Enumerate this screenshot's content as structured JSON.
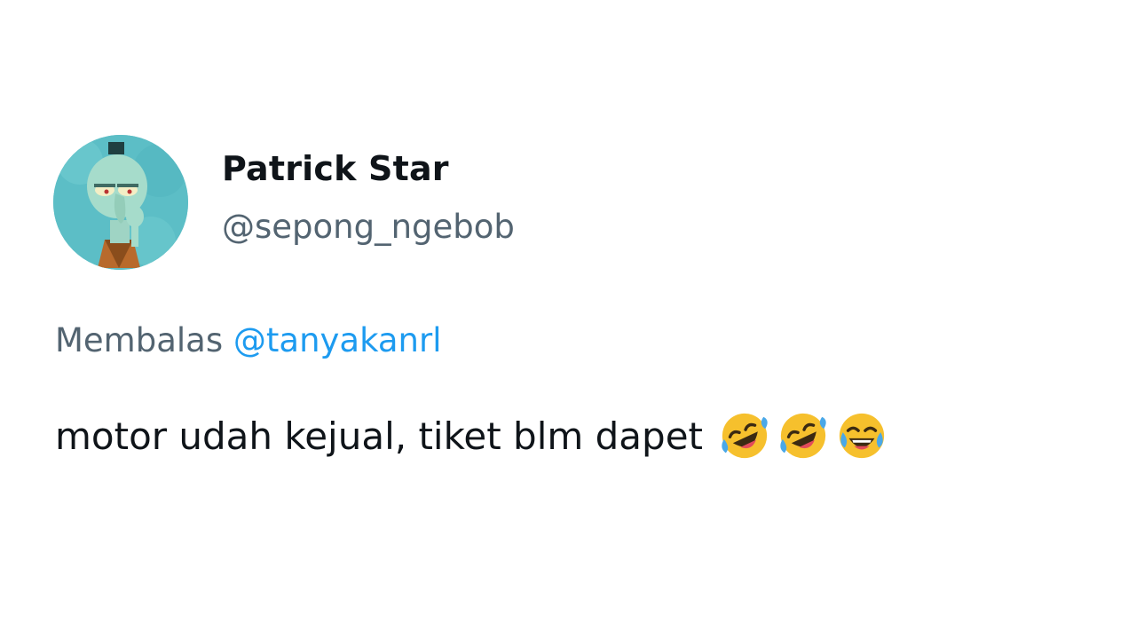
{
  "tweet": {
    "author": {
      "display_name": "Patrick Star",
      "handle": "@sepong_ngebob",
      "avatar": "squidward-avatar"
    },
    "reply": {
      "prefix": "Membalas",
      "mention": "@tanyakanrl"
    },
    "text": "motor udah kejual, tiket blm dapet",
    "emojis": [
      "rolling-on-floor-laughing-icon",
      "rolling-on-floor-laughing-icon",
      "face-with-tears-of-joy-icon"
    ]
  },
  "colors": {
    "text_primary": "#0f1419",
    "text_secondary": "#536471",
    "mention": "#1d9bf0",
    "background": "#ffffff"
  }
}
